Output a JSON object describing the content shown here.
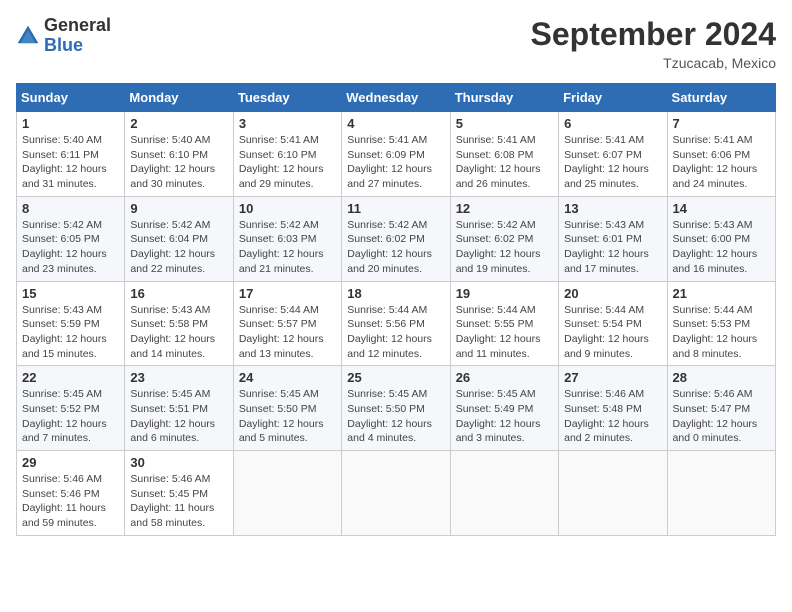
{
  "header": {
    "logo_general": "General",
    "logo_blue": "Blue",
    "month_title": "September 2024",
    "location": "Tzucacab, Mexico"
  },
  "columns": [
    "Sunday",
    "Monday",
    "Tuesday",
    "Wednesday",
    "Thursday",
    "Friday",
    "Saturday"
  ],
  "weeks": [
    [
      {
        "day": "1",
        "sunrise": "Sunrise: 5:40 AM",
        "sunset": "Sunset: 6:11 PM",
        "daylight": "Daylight: 12 hours and 31 minutes."
      },
      {
        "day": "2",
        "sunrise": "Sunrise: 5:40 AM",
        "sunset": "Sunset: 6:10 PM",
        "daylight": "Daylight: 12 hours and 30 minutes."
      },
      {
        "day": "3",
        "sunrise": "Sunrise: 5:41 AM",
        "sunset": "Sunset: 6:10 PM",
        "daylight": "Daylight: 12 hours and 29 minutes."
      },
      {
        "day": "4",
        "sunrise": "Sunrise: 5:41 AM",
        "sunset": "Sunset: 6:09 PM",
        "daylight": "Daylight: 12 hours and 27 minutes."
      },
      {
        "day": "5",
        "sunrise": "Sunrise: 5:41 AM",
        "sunset": "Sunset: 6:08 PM",
        "daylight": "Daylight: 12 hours and 26 minutes."
      },
      {
        "day": "6",
        "sunrise": "Sunrise: 5:41 AM",
        "sunset": "Sunset: 6:07 PM",
        "daylight": "Daylight: 12 hours and 25 minutes."
      },
      {
        "day": "7",
        "sunrise": "Sunrise: 5:41 AM",
        "sunset": "Sunset: 6:06 PM",
        "daylight": "Daylight: 12 hours and 24 minutes."
      }
    ],
    [
      {
        "day": "8",
        "sunrise": "Sunrise: 5:42 AM",
        "sunset": "Sunset: 6:05 PM",
        "daylight": "Daylight: 12 hours and 23 minutes."
      },
      {
        "day": "9",
        "sunrise": "Sunrise: 5:42 AM",
        "sunset": "Sunset: 6:04 PM",
        "daylight": "Daylight: 12 hours and 22 minutes."
      },
      {
        "day": "10",
        "sunrise": "Sunrise: 5:42 AM",
        "sunset": "Sunset: 6:03 PM",
        "daylight": "Daylight: 12 hours and 21 minutes."
      },
      {
        "day": "11",
        "sunrise": "Sunrise: 5:42 AM",
        "sunset": "Sunset: 6:02 PM",
        "daylight": "Daylight: 12 hours and 20 minutes."
      },
      {
        "day": "12",
        "sunrise": "Sunrise: 5:42 AM",
        "sunset": "Sunset: 6:02 PM",
        "daylight": "Daylight: 12 hours and 19 minutes."
      },
      {
        "day": "13",
        "sunrise": "Sunrise: 5:43 AM",
        "sunset": "Sunset: 6:01 PM",
        "daylight": "Daylight: 12 hours and 17 minutes."
      },
      {
        "day": "14",
        "sunrise": "Sunrise: 5:43 AM",
        "sunset": "Sunset: 6:00 PM",
        "daylight": "Daylight: 12 hours and 16 minutes."
      }
    ],
    [
      {
        "day": "15",
        "sunrise": "Sunrise: 5:43 AM",
        "sunset": "Sunset: 5:59 PM",
        "daylight": "Daylight: 12 hours and 15 minutes."
      },
      {
        "day": "16",
        "sunrise": "Sunrise: 5:43 AM",
        "sunset": "Sunset: 5:58 PM",
        "daylight": "Daylight: 12 hours and 14 minutes."
      },
      {
        "day": "17",
        "sunrise": "Sunrise: 5:44 AM",
        "sunset": "Sunset: 5:57 PM",
        "daylight": "Daylight: 12 hours and 13 minutes."
      },
      {
        "day": "18",
        "sunrise": "Sunrise: 5:44 AM",
        "sunset": "Sunset: 5:56 PM",
        "daylight": "Daylight: 12 hours and 12 minutes."
      },
      {
        "day": "19",
        "sunrise": "Sunrise: 5:44 AM",
        "sunset": "Sunset: 5:55 PM",
        "daylight": "Daylight: 12 hours and 11 minutes."
      },
      {
        "day": "20",
        "sunrise": "Sunrise: 5:44 AM",
        "sunset": "Sunset: 5:54 PM",
        "daylight": "Daylight: 12 hours and 9 minutes."
      },
      {
        "day": "21",
        "sunrise": "Sunrise: 5:44 AM",
        "sunset": "Sunset: 5:53 PM",
        "daylight": "Daylight: 12 hours and 8 minutes."
      }
    ],
    [
      {
        "day": "22",
        "sunrise": "Sunrise: 5:45 AM",
        "sunset": "Sunset: 5:52 PM",
        "daylight": "Daylight: 12 hours and 7 minutes."
      },
      {
        "day": "23",
        "sunrise": "Sunrise: 5:45 AM",
        "sunset": "Sunset: 5:51 PM",
        "daylight": "Daylight: 12 hours and 6 minutes."
      },
      {
        "day": "24",
        "sunrise": "Sunrise: 5:45 AM",
        "sunset": "Sunset: 5:50 PM",
        "daylight": "Daylight: 12 hours and 5 minutes."
      },
      {
        "day": "25",
        "sunrise": "Sunrise: 5:45 AM",
        "sunset": "Sunset: 5:50 PM",
        "daylight": "Daylight: 12 hours and 4 minutes."
      },
      {
        "day": "26",
        "sunrise": "Sunrise: 5:45 AM",
        "sunset": "Sunset: 5:49 PM",
        "daylight": "Daylight: 12 hours and 3 minutes."
      },
      {
        "day": "27",
        "sunrise": "Sunrise: 5:46 AM",
        "sunset": "Sunset: 5:48 PM",
        "daylight": "Daylight: 12 hours and 2 minutes."
      },
      {
        "day": "28",
        "sunrise": "Sunrise: 5:46 AM",
        "sunset": "Sunset: 5:47 PM",
        "daylight": "Daylight: 12 hours and 0 minutes."
      }
    ],
    [
      {
        "day": "29",
        "sunrise": "Sunrise: 5:46 AM",
        "sunset": "Sunset: 5:46 PM",
        "daylight": "Daylight: 11 hours and 59 minutes."
      },
      {
        "day": "30",
        "sunrise": "Sunrise: 5:46 AM",
        "sunset": "Sunset: 5:45 PM",
        "daylight": "Daylight: 11 hours and 58 minutes."
      },
      null,
      null,
      null,
      null,
      null
    ]
  ]
}
